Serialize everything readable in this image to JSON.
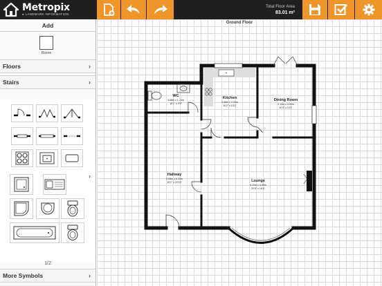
{
  "app": {
    "name": "Metropix",
    "tagline": "● LANDMARK INFORMATION"
  },
  "toolbar": {
    "buttons": [
      {
        "name": "add-page",
        "icon": "page-add-icon"
      },
      {
        "name": "undo",
        "icon": "undo-icon"
      },
      {
        "name": "redo",
        "icon": "redo-icon"
      },
      {
        "name": "save",
        "icon": "floppy-disk-icon"
      },
      {
        "name": "confirm",
        "icon": "checkbox-icon"
      },
      {
        "name": "settings",
        "icon": "gear-icon"
      }
    ],
    "area_label": "Total Floor Area",
    "area_value": "83.01 m²"
  },
  "sidebar": {
    "add_header": "Add",
    "room_label": "Room",
    "sections": {
      "floors": "Floors",
      "stairs": "Stairs",
      "more_symbols": "More Symbols"
    },
    "page_indicator": "1/2"
  },
  "canvas": {
    "floor_title": "Ground Floor",
    "rooms": [
      {
        "name": "WC",
        "dims_m": "3.08m x 1.74m",
        "dims_ft": "10'1\" x 5'9\""
      },
      {
        "name": "Kitchen",
        "dims_m": "3.08m x 4.00m",
        "dims_ft": "10'2\" x 13'1\""
      },
      {
        "name": "Dining Room",
        "dims_m": "3.13m x 4.00m",
        "dims_ft": "10'3\" x 13'1\""
      },
      {
        "name": "Hallway",
        "dims_m": "3.08m x 6.33m",
        "dims_ft": "10'1\" x 20'10\""
      },
      {
        "name": "Lounge",
        "dims_m": "6.22m x 4.99m",
        "dims_ft": "20'5\" x 16'4\""
      }
    ]
  },
  "colors": {
    "accent": "#f0952a",
    "topbar": "#1f1f1f",
    "wall": "#111111"
  }
}
